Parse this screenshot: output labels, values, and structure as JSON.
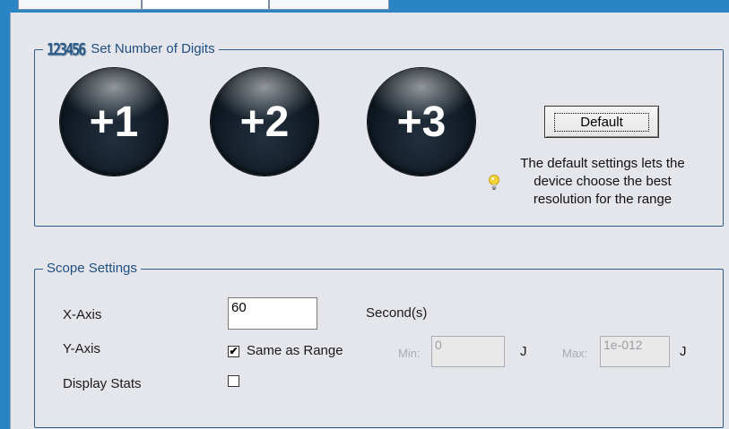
{
  "digits_group": {
    "title": "Set Number of Digits",
    "icon_text": "123456",
    "buttons": [
      "+1",
      "+2",
      "+3"
    ],
    "default_label": "Default",
    "hint": "The default settings lets the device choose the best resolution for the range"
  },
  "scope_group": {
    "title": "Scope Settings",
    "x_axis": {
      "label": "X-Axis",
      "value": "60",
      "unit": "Second(s)"
    },
    "y_axis": {
      "label": "Y-Axis",
      "same_as_range_label": "Same as Range",
      "same_as_range_checked": "✔",
      "min_label": "Min:",
      "min_value": "0",
      "min_unit": "J",
      "max_label": "Max:",
      "max_value": "1e-012",
      "max_unit": "J"
    },
    "display_stats": {
      "label": "Display Stats",
      "checked": ""
    }
  },
  "colors": {
    "frame_blue": "#2b84c4",
    "panel_bg": "#e4e6ec",
    "group_border": "#2e5b8a",
    "title_text": "#1f4e80"
  }
}
